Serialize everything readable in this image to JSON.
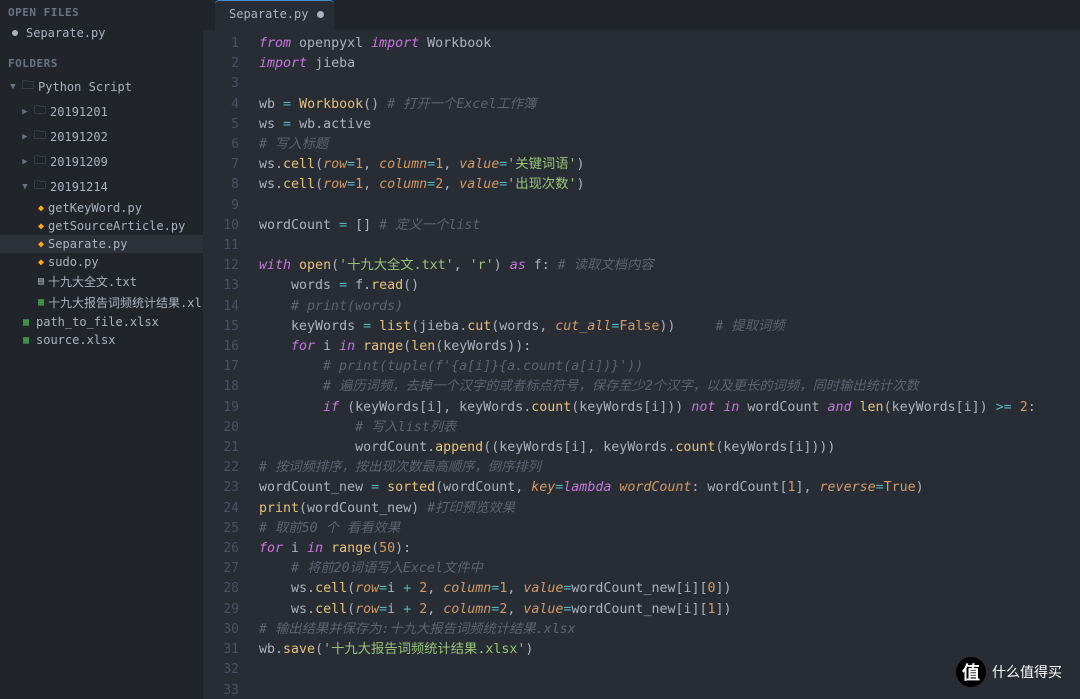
{
  "sidebar": {
    "openFilesHeader": "OPEN FILES",
    "openFiles": [
      "Separate.py"
    ],
    "foldersHeader": "FOLDERS",
    "root": "Python Script",
    "folders": [
      "20191201",
      "20191202",
      "20191209",
      "20191214"
    ],
    "files214": [
      {
        "name": "getKeyWord.py",
        "icon": "py"
      },
      {
        "name": "getSourceArticle.py",
        "icon": "py"
      },
      {
        "name": "Separate.py",
        "icon": "py",
        "selected": true
      },
      {
        "name": "sudo.py",
        "icon": "py"
      },
      {
        "name": "十九大全文.txt",
        "icon": "txt"
      },
      {
        "name": "十九大报告词频统计结果.xlsx",
        "icon": "xlsx"
      }
    ],
    "rootFiles": [
      {
        "name": "path_to_file.xlsx",
        "icon": "xlsx"
      },
      {
        "name": "source.xlsx",
        "icon": "xlsx"
      }
    ]
  },
  "tab": {
    "title": "Separate.py"
  },
  "lines": [
    {
      "n": 1,
      "mod": false,
      "html": "<span class='kw'>from</span> <span class='pln'>openpyxl</span> <span class='kw'>import</span> <span class='pln'>Workbook</span>"
    },
    {
      "n": 2,
      "mod": false,
      "html": "<span class='kw'>import</span> <span class='pln'>jieba</span>"
    },
    {
      "n": 3,
      "mod": false,
      "html": ""
    },
    {
      "n": 4,
      "mod": true,
      "html": "<span class='pln'>wb</span> <span class='op'>=</span> <span class='fn'>Workbook</span><span class='pln'>()</span> <span class='cmt'># 打开一个Excel工作簿</span>"
    },
    {
      "n": 5,
      "mod": false,
      "html": "<span class='pln'>ws</span> <span class='op'>=</span> <span class='pln'>wb.active</span>"
    },
    {
      "n": 6,
      "mod": false,
      "html": "<span class='cmt'># 写入标题</span>"
    },
    {
      "n": 7,
      "mod": false,
      "html": "<span class='pln'>ws.</span><span class='fn'>cell</span><span class='pln'>(</span><span class='param'>row</span><span class='op'>=</span><span class='num'>1</span><span class='pln'>, </span><span class='param'>column</span><span class='op'>=</span><span class='num'>1</span><span class='pln'>, </span><span class='param'>value</span><span class='op'>=</span><span class='str'>'关键词语'</span><span class='pln'>)</span>"
    },
    {
      "n": 8,
      "mod": false,
      "html": "<span class='pln'>ws.</span><span class='fn'>cell</span><span class='pln'>(</span><span class='param'>row</span><span class='op'>=</span><span class='num'>1</span><span class='pln'>, </span><span class='param'>column</span><span class='op'>=</span><span class='num'>2</span><span class='pln'>, </span><span class='param'>value</span><span class='op'>=</span><span class='str'>'出现次数'</span><span class='pln'>)</span>"
    },
    {
      "n": 9,
      "mod": false,
      "html": ""
    },
    {
      "n": 10,
      "mod": true,
      "html": "<span class='pln'>wordCount</span> <span class='op'>=</span> <span class='pln'>[]</span> <span class='cmt'># 定义一个list</span>"
    },
    {
      "n": 11,
      "mod": false,
      "html": ""
    },
    {
      "n": 12,
      "mod": true,
      "html": "<span class='kw'>with</span> <span class='fn'>open</span><span class='pln'>(</span><span class='str'>'十九大全文.txt'</span><span class='pln'>, </span><span class='str'>'r'</span><span class='pln'>) </span><span class='kw'>as</span> <span class='pln'>f:</span> <span class='cmt'># 读取文档内容</span>"
    },
    {
      "n": 13,
      "mod": false,
      "html": "    <span class='pln'>words</span> <span class='op'>=</span> <span class='pln'>f.</span><span class='fn'>read</span><span class='pln'>()</span>"
    },
    {
      "n": 14,
      "mod": false,
      "html": "    <span class='cmt'># print(words)</span>"
    },
    {
      "n": 15,
      "mod": false,
      "html": "    <span class='pln'>keyWords</span> <span class='op'>=</span> <span class='fn'>list</span><span class='pln'>(jieba.</span><span class='fn'>cut</span><span class='pln'>(words, </span><span class='param'>cut_all</span><span class='op'>=</span><span class='bool'>False</span><span class='pln'>))</span>     <span class='cmt'># 提取词频</span>"
    },
    {
      "n": 16,
      "mod": false,
      "html": "    <span class='kw'>for</span> <span class='pln'>i</span> <span class='kw'>in</span> <span class='fn'>range</span><span class='pln'>(</span><span class='fn'>len</span><span class='pln'>(keyWords)):</span>"
    },
    {
      "n": 17,
      "mod": false,
      "html": "        <span class='cmt'># print(tuple(f'{a[i]}{a.count(a[i])}'))</span>"
    },
    {
      "n": 18,
      "mod": false,
      "html": "        <span class='cmt'># 遍历词频，去掉一个汉字的或者标点符号，保存至少2个汉字，以及更长的词频，同时输出统计次数</span>"
    },
    {
      "n": 19,
      "mod": false,
      "html": "        <span class='kw'>if</span> <span class='pln'>(keyWords[i], keyWords.</span><span class='fn'>count</span><span class='pln'>(keyWords[i]))</span> <span class='kw'>not</span> <span class='kw'>in</span> <span class='pln'>wordCount</span> <span class='kw'>and</span> <span class='fn'>len</span><span class='pln'>(keyWords[i])</span> <span class='op'>&gt;=</span> <span class='num'>2</span><span class='pln'>:</span>"
    },
    {
      "n": 20,
      "mod": false,
      "html": "            <span class='cmt'># 写入list列表</span>"
    },
    {
      "n": 21,
      "mod": false,
      "html": "            <span class='pln'>wordCount.</span><span class='fn'>append</span><span class='pln'>((keyWords[i], keyWords.</span><span class='fn'>count</span><span class='pln'>(keyWords[i])))</span>"
    },
    {
      "n": 22,
      "mod": false,
      "html": "<span class='cmt'># 按词频排序，按出现次数最高顺序，倒序排列</span>"
    },
    {
      "n": 23,
      "mod": false,
      "html": "<span class='pln'>wordCount_new</span> <span class='op'>=</span> <span class='fn'>sorted</span><span class='pln'>(wordCount, </span><span class='param'>key</span><span class='op'>=</span><span class='kw'>lambda</span> <span class='param'>wordCount</span><span class='pln'>: wordCount[</span><span class='num'>1</span><span class='pln'>], </span><span class='param'>reverse</span><span class='op'>=</span><span class='bool'>True</span><span class='pln'>)</span>"
    },
    {
      "n": 24,
      "mod": true,
      "html": "<span class='fn'>print</span><span class='pln'>(wordCount_new)</span> <span class='cmt'>#打印预览效果</span>"
    },
    {
      "n": 25,
      "mod": false,
      "html": "<span class='cmt'># 取前50 个 看看效果</span>"
    },
    {
      "n": 26,
      "mod": true,
      "html": "<span class='kw'>for</span> <span class='pln'>i</span> <span class='kw'>in</span> <span class='fn'>range</span><span class='pln'>(</span><span class='num'>50</span><span class='pln'>):</span>"
    },
    {
      "n": 27,
      "mod": false,
      "html": "    <span class='cmt'># 将前20词语写入Excel文件中</span>"
    },
    {
      "n": 28,
      "mod": false,
      "html": "    <span class='pln'>ws.</span><span class='fn'>cell</span><span class='pln'>(</span><span class='param'>row</span><span class='op'>=</span><span class='pln'>i</span> <span class='op'>+</span> <span class='num'>2</span><span class='pln'>, </span><span class='param'>column</span><span class='op'>=</span><span class='num'>1</span><span class='pln'>, </span><span class='param'>value</span><span class='op'>=</span><span class='pln'>wordCount_new[i][</span><span class='num'>0</span><span class='pln'>])</span>"
    },
    {
      "n": 29,
      "mod": false,
      "html": "    <span class='pln'>ws.</span><span class='fn'>cell</span><span class='pln'>(</span><span class='param'>row</span><span class='op'>=</span><span class='pln'>i</span> <span class='op'>+</span> <span class='num'>2</span><span class='pln'>, </span><span class='param'>column</span><span class='op'>=</span><span class='num'>2</span><span class='pln'>, </span><span class='param'>value</span><span class='op'>=</span><span class='pln'>wordCount_new[i][</span><span class='num'>1</span><span class='pln'>])</span>"
    },
    {
      "n": 30,
      "mod": false,
      "html": "<span class='cmt'># 输出结果并保存为:十九大报告词频统计结果.xlsx</span>"
    },
    {
      "n": 31,
      "mod": false,
      "html": "<span class='pln'>wb.</span><span class='fn'>save</span><span class='pln'>(</span><span class='str'>'十九大报告词频统计结果.xlsx'</span><span class='pln'>)</span>"
    },
    {
      "n": 32,
      "mod": true,
      "html": ""
    },
    {
      "n": 33,
      "mod": false,
      "html": ""
    }
  ],
  "watermark": {
    "icon": "值",
    "text": "什么值得买"
  }
}
